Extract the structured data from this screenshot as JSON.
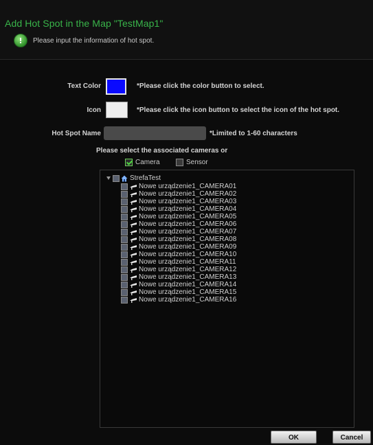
{
  "dialog": {
    "title": "Add Hot Spot in the Map \"TestMap1\"",
    "info_text": "Please input the information of hot spot."
  },
  "form": {
    "text_color_label": "Text Color",
    "text_color_value": "#0a0aff",
    "text_color_hint": "*Please click the color button to select.",
    "icon_label": "Icon",
    "icon_hint": "*Please click the icon button to select the icon of the hot spot.",
    "name_label": "Hot Spot Name",
    "name_value": "",
    "name_hint": "*Limited to 1-60 characters",
    "assoc_label": "Please select the associated cameras or",
    "camera_label": "Camera",
    "camera_checked": true,
    "sensor_label": "Sensor",
    "sensor_checked": false
  },
  "tree": {
    "root_label": "StrefaTest",
    "items": [
      "Nowe urządzenie1_CAMERA01",
      "Nowe urządzenie1_CAMERA02",
      "Nowe urządzenie1_CAMERA03",
      "Nowe urządzenie1_CAMERA04",
      "Nowe urządzenie1_CAMERA05",
      "Nowe urządzenie1_CAMERA06",
      "Nowe urządzenie1_CAMERA07",
      "Nowe urządzenie1_CAMERA08",
      "Nowe urządzenie1_CAMERA09",
      "Nowe urządzenie1_CAMERA10",
      "Nowe urządzenie1_CAMERA11",
      "Nowe urządzenie1_CAMERA12",
      "Nowe urządzenie1_CAMERA13",
      "Nowe urządzenie1_CAMERA14",
      "Nowe urządzenie1_CAMERA15",
      "Nowe urządzenie1_CAMERA16"
    ]
  },
  "buttons": {
    "ok": "OK",
    "cancel": "Cancel"
  },
  "colors": {
    "title": "#39b54a",
    "background": "#0c0c0c",
    "checkmark": "#4cd43e"
  }
}
